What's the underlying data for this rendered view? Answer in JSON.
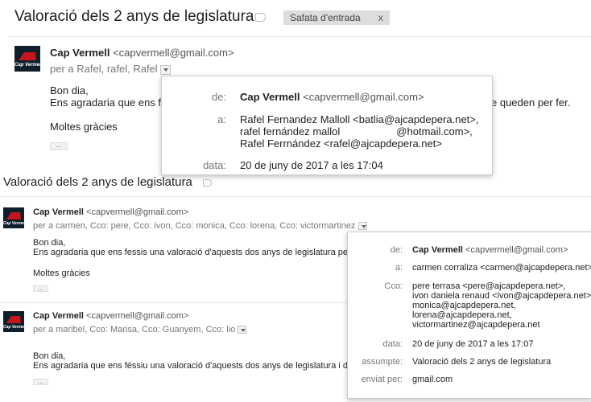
{
  "colors": {
    "logo_bg": "#0f1e2b",
    "logo_red": "#c4161c",
    "chip_bg": "#dddddd"
  },
  "top": {
    "subject": "Valoració dels 2 anys de legislatura",
    "chip": {
      "label": "Safata d'entrada",
      "close": "x"
    },
    "message": {
      "logo_text": "Cap Vermell",
      "sender_name": "Cap Vermell",
      "sender_email": "<capvermell@gmail.com>",
      "recipients": "per a Rafel, rafel, Rafel",
      "body_greeting": "Bon dia,",
      "body_line": "Ens agradaria que ens fe",
      "body_line_tail": "e queden per fer.",
      "body_thanks": "Moltes gràcies",
      "ellipsis": "..."
    },
    "popup": {
      "from_label": "de:",
      "from_name": "Cap Vermell",
      "from_email": "<capvermell@gmail.com>",
      "to_label": "a:",
      "to_lines": [
        "Rafel Fernandez Malloll <batlia@ajcapdepera.net>,",
        "rafel fernández mallol",
        "@hotmail.com>,",
        "Rafel Ferrnández <rafel@ajcapdepera.net>"
      ],
      "date_label": "data:",
      "date": "20 de juny de 2017 a les 17:04"
    }
  },
  "second": {
    "subject": "Valoració dels 2 anys de legislatura",
    "message1": {
      "logo_text": "Cap Vermell",
      "sender_name": "Cap Vermell",
      "sender_email": "<capvermell@gmail.com>",
      "recipients": "per a carmen, Cco: pere, Cco: ivon, Cco: monica, Cco: lorena, Cco: victormartinez",
      "body_greeting": "Bon dia,",
      "body_line": "Ens agradaria que ens fessis una valoració d'aquests dos anys de legislatura pel qu",
      "body_thanks": "Moltes gràcies",
      "ellipsis": "..."
    },
    "message2": {
      "logo_text": "Cap Vermell",
      "sender_name": "Cap Vermell",
      "sender_email": "<capvermell@gmail.com>",
      "recipients": "per a maribel, Cco: Marisa, Cco: Guanyem, Cco: lio",
      "body_greeting": "Bon dia,",
      "body_line": "Ens agradaria que ens féssiu una valoració d'aquests dos anys de legislatura i dels",
      "ellipsis": "..."
    },
    "popup": {
      "from_label": "de:",
      "from_name": "Cap Vermell",
      "from_email": "<capvermell@gmail.com>",
      "to_label": "a:",
      "to_value": "carmen corraliza <carmen@ajcapdepera.net>",
      "cco_label": "Cco:",
      "cco_lines": [
        "pere terrasa <pere@ajcapdepera.net>,",
        "ivon daniela renaud <ivon@ajcapdepera.net>,",
        "monica@ajcapdepera.net,",
        "lorena@ajcapdepera.net,",
        "victormartinez@ajcapdepera.net"
      ],
      "date_label": "data:",
      "date": "20 de juny de 2017 a les 17:07",
      "subject_label": "assumpte:",
      "subject": "Valoració dels 2 anys de legislatura",
      "via_label": "enviat per:",
      "via": "gmail.com"
    }
  }
}
